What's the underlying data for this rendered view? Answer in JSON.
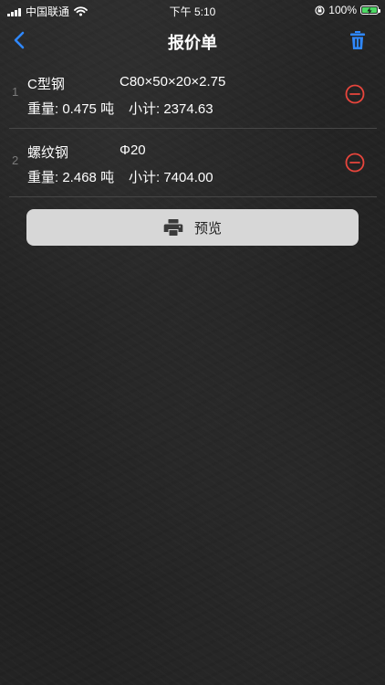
{
  "status_bar": {
    "carrier": "中国联通",
    "time": "下午 5:10",
    "battery_percent": "100%",
    "battery_level": 1.0,
    "colors": {
      "battery_fill": "#4cd964"
    },
    "icons": [
      "signal-icon",
      "wifi-icon",
      "orientation-lock-icon",
      "battery-icon"
    ]
  },
  "nav": {
    "title": "报价单",
    "back_icon": "chevron-left-icon",
    "delete_icon": "trash-icon",
    "colors": {
      "accent": "#2f88ff"
    }
  },
  "items": [
    {
      "index": "1",
      "name": "C型钢",
      "spec": "C80×50×20×2.75",
      "weight_label": "重量:",
      "weight": "0.475",
      "weight_unit": "吨",
      "subtotal_label": "小计:",
      "subtotal": "2374.63",
      "remove_icon": "minus-circle-icon"
    },
    {
      "index": "2",
      "name": "螺纹钢",
      "spec": "Φ20",
      "weight_label": "重量:",
      "weight": "2.468",
      "weight_unit": "吨",
      "subtotal_label": "小计:",
      "subtotal": "7404.00",
      "remove_icon": "minus-circle-icon"
    }
  ],
  "preview_button": {
    "label": "预览",
    "icon": "printer-icon"
  },
  "colors": {
    "remove": "#e8453c",
    "button_bg": "#d7d7d7"
  }
}
